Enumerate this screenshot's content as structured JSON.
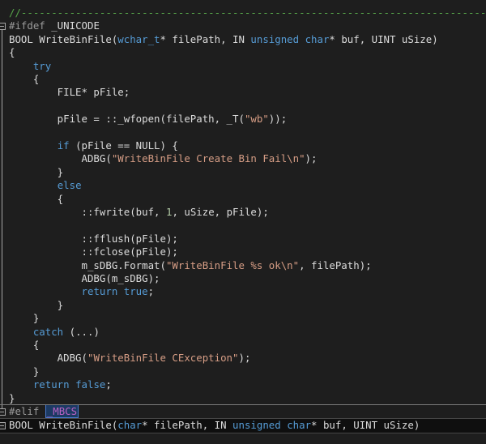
{
  "editor": {
    "lines": [
      [
        [
          "t-comment",
          "//-----------------------------------------------------------------------------"
        ]
      ],
      [
        [
          "t-pre",
          "#ifdef"
        ],
        [
          "t-plain",
          " _UNICODE"
        ]
      ],
      [
        [
          "t-plain",
          "BOOL WriteBinFile("
        ],
        [
          "t-kw",
          "wchar_t"
        ],
        [
          "t-plain",
          "* filePath, IN "
        ],
        [
          "t-kw",
          "unsigned"
        ],
        [
          "t-plain",
          " "
        ],
        [
          "t-kw",
          "char"
        ],
        [
          "t-plain",
          "* buf, UINT uSize)"
        ]
      ],
      [
        [
          "t-plain",
          "{"
        ]
      ],
      [
        [
          "t-plain",
          "    "
        ],
        [
          "t-kw",
          "try"
        ]
      ],
      [
        [
          "t-plain",
          "    {"
        ]
      ],
      [
        [
          "t-plain",
          "        FILE* pFile;"
        ]
      ],
      [
        [
          "t-plain",
          ""
        ]
      ],
      [
        [
          "t-plain",
          "        pFile = ::_wfopen(filePath, _T("
        ],
        [
          "t-str",
          "\"wb\""
        ],
        [
          "t-plain",
          "));"
        ]
      ],
      [
        [
          "t-plain",
          ""
        ]
      ],
      [
        [
          "t-plain",
          "        "
        ],
        [
          "t-kw",
          "if"
        ],
        [
          "t-plain",
          " (pFile == NULL) {"
        ]
      ],
      [
        [
          "t-plain",
          "            ADBG("
        ],
        [
          "t-str",
          "\"WriteBinFile Create Bin Fail\\n\""
        ],
        [
          "t-plain",
          ");"
        ]
      ],
      [
        [
          "t-plain",
          "        }"
        ]
      ],
      [
        [
          "t-plain",
          "        "
        ],
        [
          "t-kw",
          "else"
        ]
      ],
      [
        [
          "t-plain",
          "        {"
        ]
      ],
      [
        [
          "t-plain",
          "            ::fwrite(buf, "
        ],
        [
          "t-num",
          "1"
        ],
        [
          "t-plain",
          ", uSize, pFile);"
        ]
      ],
      [
        [
          "t-plain",
          ""
        ]
      ],
      [
        [
          "t-plain",
          "            ::fflush(pFile);"
        ]
      ],
      [
        [
          "t-plain",
          "            ::fclose(pFile);"
        ]
      ],
      [
        [
          "t-plain",
          "            m_sDBG.Format("
        ],
        [
          "t-str",
          "\"WriteBinFile %s ok\\n\""
        ],
        [
          "t-plain",
          ", filePath);"
        ]
      ],
      [
        [
          "t-plain",
          "            ADBG(m_sDBG);"
        ]
      ],
      [
        [
          "t-plain",
          "            "
        ],
        [
          "t-kw",
          "return"
        ],
        [
          "t-plain",
          " "
        ],
        [
          "t-kw",
          "true"
        ],
        [
          "t-plain",
          ";"
        ]
      ],
      [
        [
          "t-plain",
          "        }"
        ]
      ],
      [
        [
          "t-plain",
          "    }"
        ]
      ],
      [
        [
          "t-plain",
          "    "
        ],
        [
          "t-kw",
          "catch"
        ],
        [
          "t-plain",
          " (...)"
        ]
      ],
      [
        [
          "t-plain",
          "    {"
        ]
      ],
      [
        [
          "t-plain",
          "        ADBG("
        ],
        [
          "t-str",
          "\"WriteBinFile CException\""
        ],
        [
          "t-plain",
          ");"
        ]
      ],
      [
        [
          "t-plain",
          "    }"
        ]
      ],
      [
        [
          "t-plain",
          "    "
        ],
        [
          "t-kw",
          "return"
        ],
        [
          "t-plain",
          " "
        ],
        [
          "t-kw",
          "false"
        ],
        [
          "t-plain",
          ";"
        ]
      ],
      [
        [
          "t-plain",
          "}"
        ]
      ],
      [
        [
          "t-pre",
          "#elif"
        ],
        [
          "t-plain",
          " "
        ],
        [
          "t-macro-hl",
          "_MBCS"
        ]
      ],
      [
        [
          "t-plain",
          "BOOL WriteBinFile("
        ],
        [
          "t-kw",
          "char"
        ],
        [
          "t-plain",
          "* filePath, IN "
        ],
        [
          "t-kw",
          "unsigned"
        ],
        [
          "t-plain",
          " "
        ],
        [
          "t-kw",
          "char"
        ],
        [
          "t-plain",
          "* buf, UINT uSize)"
        ]
      ]
    ]
  }
}
